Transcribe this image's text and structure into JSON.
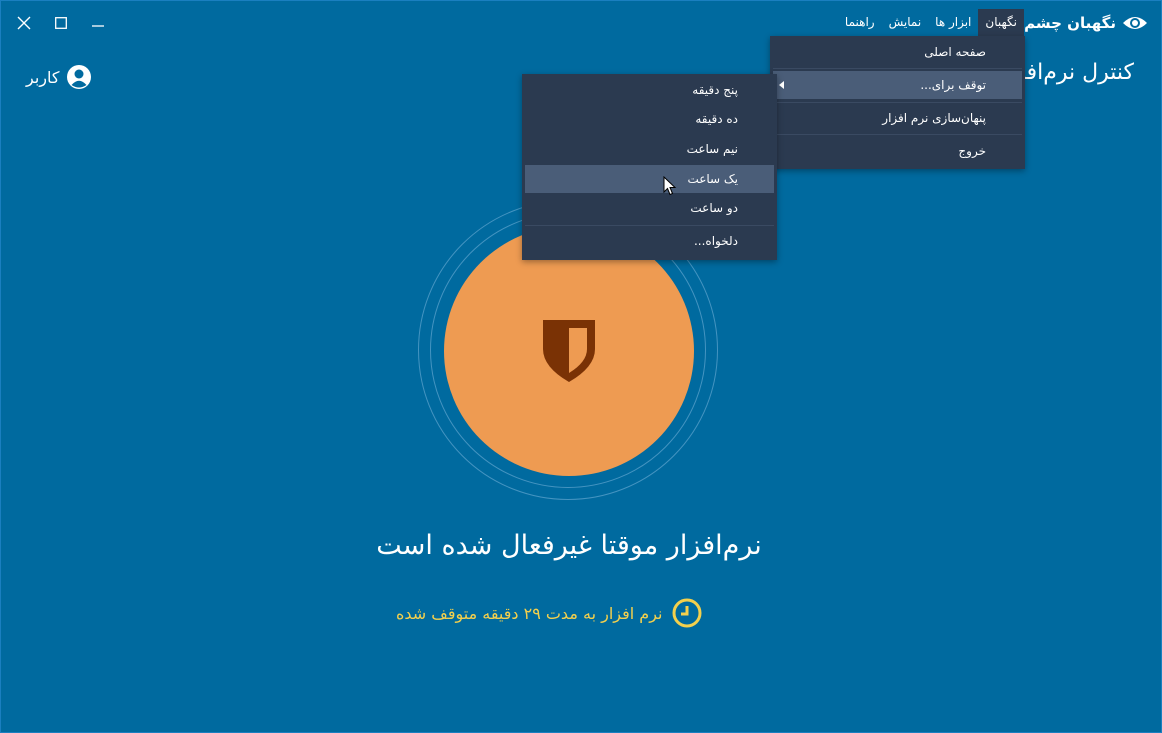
{
  "app": {
    "title": "نگهبان چشم",
    "page_heading": "کنترل نرم‌افزار"
  },
  "menubar": {
    "items": [
      {
        "label": "نگهبان"
      },
      {
        "label": "ابزار ها"
      },
      {
        "label": "نمایش"
      },
      {
        "label": "راهنما"
      }
    ]
  },
  "user": {
    "label": "کاربر"
  },
  "main_menu": {
    "items": [
      {
        "label": "صفحه اصلی"
      },
      {
        "label": "توقف برای..."
      },
      {
        "label": "پنهان‌سازی نرم افزار"
      },
      {
        "label": "خروج"
      }
    ]
  },
  "sub_menu": {
    "items": [
      {
        "label": "پنج دقیقه"
      },
      {
        "label": "ده دقیقه"
      },
      {
        "label": "نیم ساعت"
      },
      {
        "label": "یک ساعت"
      },
      {
        "label": "دو ساعت"
      },
      {
        "label": "دلخواه..."
      }
    ]
  },
  "status": {
    "title": "نرم‌افزار موقتا غیرفعال شده است",
    "subtitle": "نرم افزار به مدت ۲۹ دقیقه متوقف شده"
  },
  "colors": {
    "background": "#006a9f",
    "menu_bg": "#2b3a50",
    "menu_highlight": "#4a5d78",
    "accent_orange": "#ee9b52",
    "shield": "#7a3205",
    "status_yellow": "#f3d04d"
  },
  "icons": {
    "brand": "eye-icon",
    "user": "user-avatar-icon",
    "status": "shield-icon",
    "timer": "clock-icon"
  }
}
